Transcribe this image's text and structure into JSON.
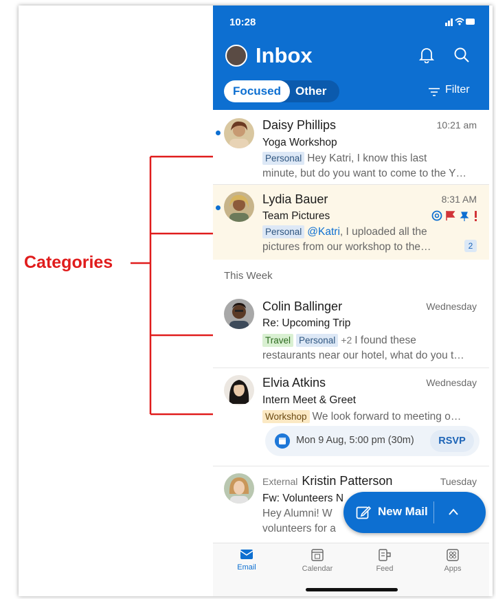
{
  "annotation": {
    "label": "Categories",
    "color": "#e01c1c"
  },
  "status_bar": {
    "time": "10:28"
  },
  "header": {
    "title": "Inbox",
    "tabs": [
      {
        "label": "Focused",
        "active": true
      },
      {
        "label": "Other",
        "active": false
      }
    ],
    "filter_label": "Filter",
    "accent": "#0d6fd1"
  },
  "section_label": "This Week",
  "emails": [
    {
      "sender": "Daisy Phillips",
      "time": "10:21 am",
      "subject": "Yoga Workshop",
      "tags": [
        "Personal"
      ],
      "preview_line1": "Hey Katri, I know this last",
      "preview_line2": "minute, but do you want to come to the Y…",
      "unread": true
    },
    {
      "sender": "Lydia Bauer",
      "time": "8:31 AM",
      "subject": "Team Pictures",
      "tags": [
        "Personal"
      ],
      "mention": "@Katri",
      "preview_line1": ", I uploaded all the",
      "preview_line2": "pictures from our workshop to the…",
      "count": "2",
      "unread": true,
      "highlighted": true
    },
    {
      "sender": "Colin Ballinger",
      "time": "Wednesday",
      "subject": "Re: Upcoming Trip",
      "tags": [
        "Travel",
        "Personal"
      ],
      "more_tags": "+2",
      "preview_line1": "I found these",
      "preview_line2": "restaurants near our hotel, what do you t…"
    },
    {
      "sender": "Elvia Atkins",
      "time": "Wednesday",
      "subject": "Intern Meet & Greet",
      "tags": [
        "Workshop"
      ],
      "preview_line1": "We look forward to meeting o…",
      "event": {
        "text": "Mon 9 Aug, 5:00 pm (30m)",
        "action": "RSVP"
      }
    },
    {
      "external_label": "External",
      "sender": "Kristin Patterson",
      "time": "Tuesday",
      "subject": "Fw: Volunteers N",
      "preview_line1": "Hey Alumni! W",
      "preview_line2": "volunteers for a"
    }
  ],
  "fab": {
    "label": "New Mail"
  },
  "tabbar": [
    {
      "label": "Email",
      "icon": "mail-icon",
      "active": true
    },
    {
      "label": "Calendar",
      "icon": "calendar-icon"
    },
    {
      "label": "Feed",
      "icon": "feed-icon"
    },
    {
      "label": "Apps",
      "icon": "apps-icon"
    }
  ]
}
